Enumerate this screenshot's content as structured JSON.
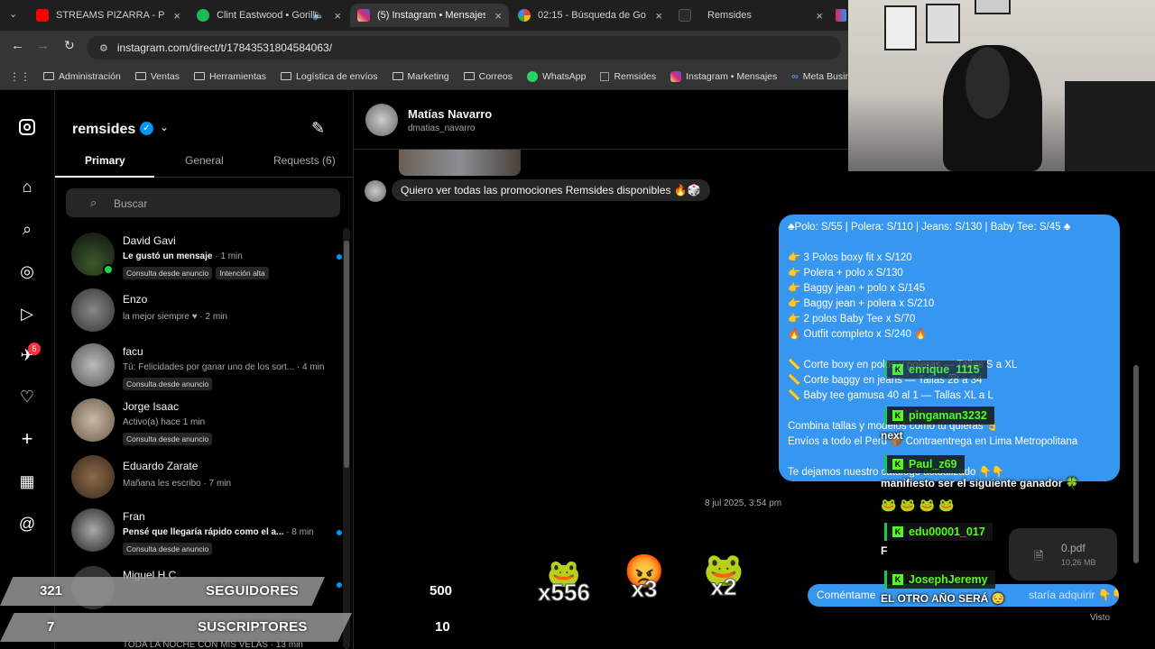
{
  "browser": {
    "tabs": [
      {
        "title": "STREAMS PIZARRA - Pizar",
        "icon": "youtube-icon",
        "color": "#ff0000"
      },
      {
        "title": "Clint Eastwood • Gorill",
        "icon": "spotify-icon",
        "color": "#1db954"
      },
      {
        "title": "(5) Instagram • Mensajes",
        "icon": "instagram-icon",
        "color": "#d6249f"
      },
      {
        "title": "02:15 - Búsqueda de Goog",
        "icon": "google-icon",
        "color": "#4285f4"
      },
      {
        "title": "Remsides",
        "icon": "remsides-icon",
        "color": "#555555"
      }
    ],
    "url": "instagram.com/direct/t/17843531804584063/",
    "bookmarks": [
      "Administración",
      "Ventas",
      "Herramientas",
      "Logística de envíos",
      "Marketing",
      "Correos",
      "WhatsApp",
      "Remsides",
      "Instagram • Mensajes",
      "Meta Business"
    ]
  },
  "rail": {
    "notif_badge": "5"
  },
  "inbox": {
    "account": "remsides",
    "tabs": [
      "Primary",
      "General",
      "Requests (6)"
    ],
    "search_placeholder": "Buscar",
    "conversations": [
      {
        "name": "David Gavi",
        "preview": "Le gustó un mensaje",
        "time": " · 1 min",
        "tags": [
          "Consulta desde anuncio",
          "Intención alta"
        ],
        "unread": true,
        "bold": true
      },
      {
        "name": "Enzo",
        "preview": "la mejor siempre ♥",
        "time": " · 2 min",
        "tags": [],
        "unread": false,
        "bold": false
      },
      {
        "name": "facu",
        "preview": "Tú: Felicidades por ganar uno de los sort...",
        "time": " · 4 min",
        "tags": [
          "Consulta desde anuncio"
        ],
        "unread": false,
        "bold": false
      },
      {
        "name": "Jorge Isaac",
        "preview": "Activo(a) hace 1 min",
        "time": "",
        "tags": [
          "Consulta desde anuncio"
        ],
        "unread": false,
        "bold": false
      },
      {
        "name": "Eduardo Zarate",
        "preview": "Mañana les escribo",
        "time": " · 7 min",
        "tags": [],
        "unread": false,
        "bold": false
      },
      {
        "name": "Fran",
        "preview": "Pensé que llegaría rápido como el a...",
        "time": " · 8 min",
        "tags": [
          "Consulta desde anuncio"
        ],
        "unread": true,
        "bold": true
      },
      {
        "name": "Miguel H.C",
        "preview": "",
        "time": "",
        "tags": [],
        "unread": true,
        "bold": false
      }
    ],
    "bottom_preview": "TODA LA NOCHE CON MIS VELAS · 13 min"
  },
  "thread": {
    "contact_name": "Matías Navarro",
    "contact_handle": "dmatias_navarro",
    "incoming_message": "Quiero ver todas las promociones Remsides disponibles 🔥🎲",
    "outgoing_lines": [
      "♣Polo: S/55 | Polera: S/110 | Jeans: S/130 | Baby Tee: S/45 ♣",
      "",
      "👉 3 Polos boxy fit x S/120",
      "👉 Polera + polo x S/130",
      "👉 Baggy jean + polo x S/145",
      "👉 Baggy jean + polera x S/210",
      "👉 2 polos Baby Tee x S/70",
      "🔥 Outfit completo x S/240 🔥",
      "",
      "📏 Corte boxy en polos y poleras — Tallas S a XL",
      "📏 Corte baggy en jeans — Tallas 28 a 34",
      "📏 Baby tee gamusa 40 al 1 — Tallas XL a L",
      "",
      "Combina tallas y modelos como tú quieras 👌",
      " Envíos a todo el Perú 📦 Contraentrega en Lima Metropolitana",
      "",
      "Te dejamos nuestro catálogo actualizado 👇👇"
    ],
    "timestamp": "8 jul 2025, 3:54 pm",
    "file_name": "0.pdf",
    "file_size": "10,26 MB",
    "reply_preview": "Coméntame",
    "reply_preview_tail": "staría adquirir 👇👇",
    "seen": "Visto"
  },
  "stream": {
    "chat": [
      {
        "user": "enrique_1115",
        "msg": ""
      },
      {
        "user": "pingaman3232",
        "msg": "next"
      },
      {
        "user": "Paul_z69",
        "msg": "manifiesto ser el siguiente ganador 🍀"
      },
      {
        "user": "edu00001_017",
        "msg": "F"
      },
      {
        "user": "JosephJeremy",
        "msg": "EL OTRO AÑO SERÁ 😔"
      }
    ],
    "emote_row": "🐸 🐸 🐸 🐸",
    "seguidores_count": "321",
    "seguidores_label": "SEGUIDORES",
    "suscriptores_count": "7",
    "suscriptores_label": "SUSCRIPTORES",
    "goal_followers": "500",
    "goal_subs": "10",
    "gifts": [
      {
        "mult": "x556",
        "emoji": "🐸"
      },
      {
        "mult": "x3",
        "emoji": "😡"
      },
      {
        "mult": "x2",
        "emoji": "🐸"
      }
    ]
  }
}
